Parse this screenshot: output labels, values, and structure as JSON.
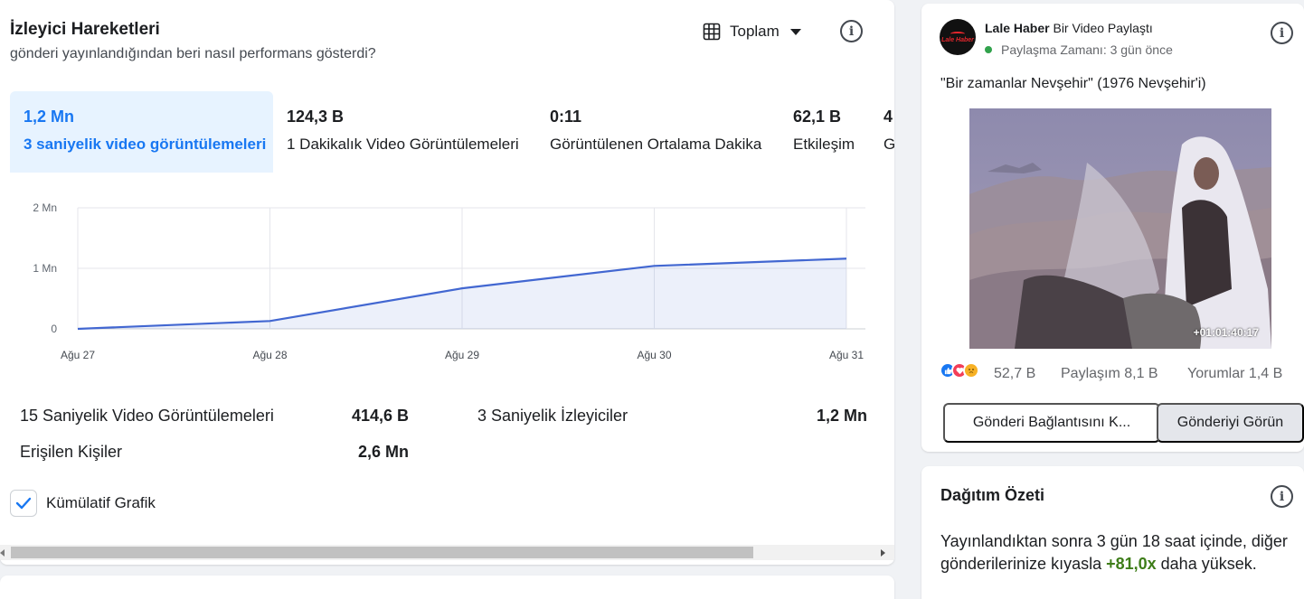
{
  "header": {
    "title": "İzleyici Hareketleri",
    "subtitle": "gönderi yayınlandığından beri nasıl performans gösterdi?",
    "view_selector": "Toplam",
    "info": "i"
  },
  "tabs": [
    {
      "value": "1,2 Mn",
      "label": "3 saniyelik video görüntülemeleri",
      "active": true
    },
    {
      "value": "124,3 B",
      "label": "1 Dakikalık Video Görüntülemeleri"
    },
    {
      "value": "0:11",
      "label": "Görüntülenen Ortalama Dakika"
    },
    {
      "value": "62,1 B",
      "label": "Etkileşim"
    },
    {
      "value": "4",
      "label": "G"
    }
  ],
  "chart_data": {
    "type": "area",
    "x": [
      "Ağu 27",
      "Ağu 28",
      "Ağu 29",
      "Ağu 30",
      "Ağu 31"
    ],
    "values": [
      0,
      0.13,
      0.67,
      1.04,
      1.16
    ],
    "yticks": [
      "0",
      "1 Mn",
      "2 Mn"
    ],
    "ylim": [
      0,
      2
    ],
    "grid": true,
    "color": "#4267d1"
  },
  "stats": [
    {
      "label": "15 Saniyelik Video Görüntülemeleri",
      "value": "414,6 B"
    },
    {
      "label": "3 Saniyelik İzleyiciler",
      "value": "1,2 Mn"
    },
    {
      "label": "Erişilen Kişiler",
      "value": "2,6 Mn"
    }
  ],
  "cumulative": {
    "label": "Kümülatif Grafik",
    "checked": true
  },
  "post": {
    "page_name": "Lale Haber",
    "action": "Bir Video Paylaştı",
    "time": "Paylaşma Zamanı: 3 gün önce",
    "caption": "\"Bir zamanlar Nevşehir\" (1976 Nevşehir'i)",
    "video_timestamp": "+01:01:40:17",
    "reactions": "52,7 B",
    "shares": "Paylaşım 8,1 B",
    "comments": "Yorumlar 1,4 B",
    "link_button": "Gönderi Bağlantısını K...",
    "view_button": "Gönderiyi Görün",
    "logo_text": "Lale Haber"
  },
  "distribution": {
    "title": "Dağıtım Özeti",
    "text_before": "Yayınlandıktan sonra 3 gün 18 saat içinde, diğer gönderilerinize kıyasla ",
    "highlight": "+81,0x",
    "text_after": " daha yüksek."
  },
  "colors": {
    "accent": "#1877f2",
    "active_tab_bg": "#e7f3ff",
    "line": "#4267d1",
    "positive": "#3e7d19"
  }
}
